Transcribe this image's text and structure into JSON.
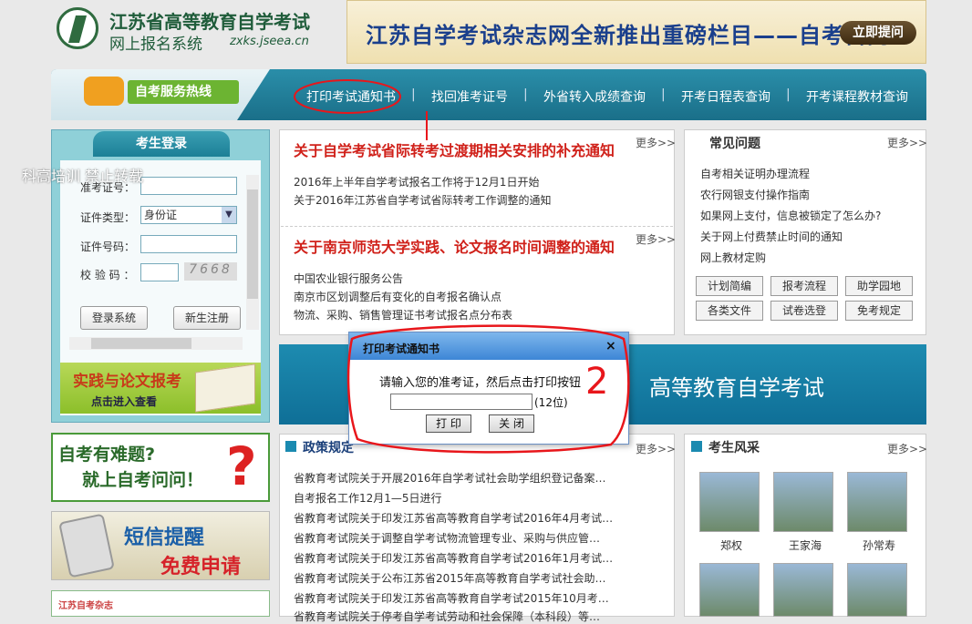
{
  "header": {
    "site_title": "江苏省高等教育自学考试",
    "site_subtitle": "网上报名系统",
    "site_domain": "zxks.jseea.cn",
    "banner_text": "江苏自学考试杂志网全新推出重磅栏目——自考百问",
    "banner_button": "立即提问"
  },
  "nav": {
    "hotline": "自考服务热线",
    "items": [
      "打印考试通知书",
      "找回准考证号",
      "外省转入成绩查询",
      "开考日程表查询",
      "开考课程教材查询"
    ],
    "separator": "|"
  },
  "login": {
    "title": "考生登录",
    "labels": [
      "准考证号：",
      "证件类型：",
      "证件号码：",
      "校 验 码 ："
    ],
    "id_type_value": "身份证",
    "captcha": "7668",
    "login_button": "登录系统",
    "register_button": "新生注册"
  },
  "left_banners": {
    "practice_title": "实践与论文报考",
    "practice_sub": "点击进入查看",
    "ask_line1": "自考有难题?",
    "ask_line2": "就上自考问问！",
    "ask_mark": "?",
    "sms_title": "短信提醒",
    "sms_free": "免费申请",
    "bottom_title": "江苏自考杂志"
  },
  "news": {
    "more": "更多>>",
    "headline1": "关于自学考试省际转考过渡期相关安排的补充通知",
    "items1": [
      "2016年上半年自学考试报名工作将于12月1日开始",
      "关于2016年江苏省自学考试省际转考工作调整的通知"
    ],
    "headline2": "关于南京师范大学实践、论文报名时间调整的通知",
    "items2": [
      "中国农业银行服务公告",
      "南京市区划调整后有变化的自考报名确认点",
      "物流、采购、销售管理证书考试报名点分布表"
    ]
  },
  "mid_banner": {
    "text": "高等教育自学考试"
  },
  "policy": {
    "title": "政策规定",
    "more": "更多>>",
    "items": [
      "省教育考试院关于开展2016年自学考试社会助学组织登记备案…",
      "自考报名工作12月1—5日进行",
      "省教育考试院关于印发江苏省高等教育自学考试2016年4月考试…",
      "省教育考试院关于调整自学考试物流管理专业、采购与供应管…",
      "省教育考试院关于印发江苏省高等教育自学考试2016年1月考试…",
      "省教育考试院关于公布江苏省2015年高等教育自学考试社会助…",
      "省教育考试院关于印发江苏省高等教育自学考试2015年10月考…",
      "省教育考试院关于停考自学考试劳动和社会保障（本科段）等…"
    ]
  },
  "faq": {
    "title": "常见问题",
    "more": "更多>>",
    "items": [
      "自考相关证明办理流程",
      "农行网银支付操作指南",
      "如果网上支付，信息被锁定了怎么办?",
      "关于网上付费禁止时间的通知",
      "网上教材定购"
    ],
    "buttons": [
      "计划简编",
      "报考流程",
      "助学园地",
      "各类文件",
      "试卷选登",
      "免考规定"
    ]
  },
  "style": {
    "title": "考生风采",
    "more": "更多>>",
    "names": [
      "郑权",
      "王家海",
      "孙常寿"
    ]
  },
  "watermark": "科高培训 禁止转载",
  "dialog": {
    "title": "打印考试通知书",
    "close": "×",
    "prompt": "请输入您的准考证，然后点击打印按钮",
    "hint": "(12位)",
    "print_button": "打 印",
    "close_button": "关 闭"
  },
  "annotation": {
    "label": "2",
    "color": "#e8161b"
  }
}
